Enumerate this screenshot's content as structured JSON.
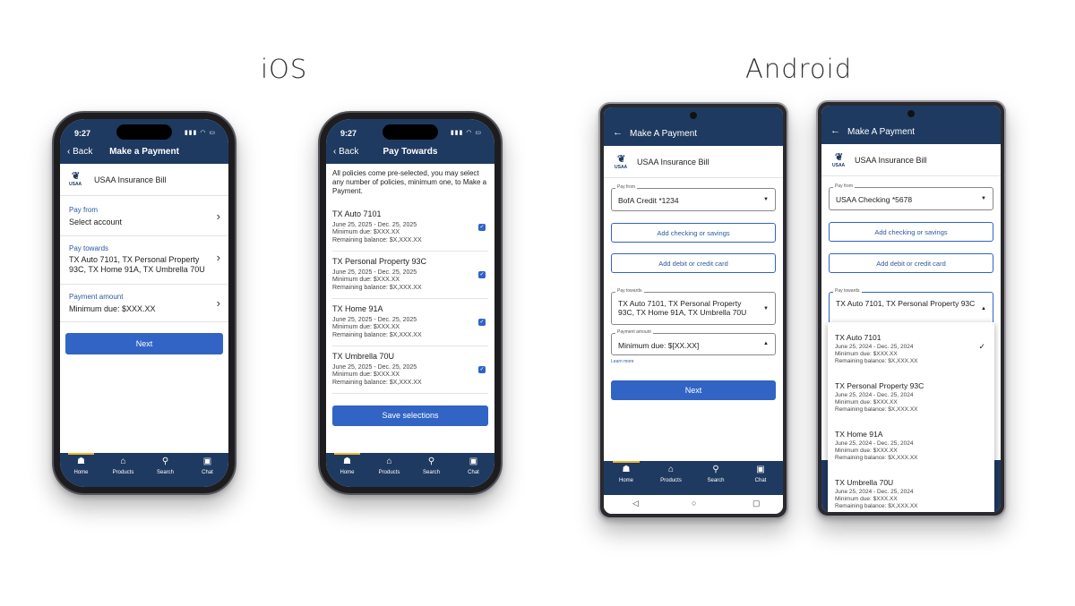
{
  "headings": {
    "ios": "iOS",
    "android": "Android"
  },
  "ios_status": {
    "time": "9:27",
    "icons": "▮▮▮ ◠ ▭"
  },
  "bill_title": "USAA Insurance Bill",
  "usaa_mark": "USAA",
  "tabs": [
    {
      "label": "Home",
      "icon": "home-icon"
    },
    {
      "label": "Products",
      "icon": "products-icon"
    },
    {
      "label": "Search",
      "icon": "search-icon"
    },
    {
      "label": "Chat",
      "icon": "chat-icon"
    }
  ],
  "ios_payment": {
    "back": "‹ Back",
    "title": "Make a Payment",
    "pay_from_label": "Pay from",
    "pay_from_value": "Select account",
    "pay_towards_label": "Pay towards",
    "pay_towards_value": "TX Auto 7101, TX Personal Property 93C, TX Home 91A, TX Umbrella 70U",
    "payment_amount_label": "Payment amount",
    "payment_amount_value": "Minimum due: $XXX.XX",
    "next_button": "Next"
  },
  "ios_towards": {
    "back": "‹ Back",
    "title": "Pay Towards",
    "intro": "All policies come pre-selected, you may select any number of policies, minimum one, to Make a Payment.",
    "policies": [
      {
        "name": "TX Auto 7101",
        "dates": "June 25, 2025 - Dec. 25, 2025",
        "min_due": "Minimum due: $XXX.XX",
        "balance": "Remaining balance: $X,XXX.XX"
      },
      {
        "name": "TX Personal Property 93C",
        "dates": "June 25, 2025 - Dec. 25, 2025",
        "min_due": "Minimum due: $XXX.XX",
        "balance": "Remaining balance: $X,XXX.XX"
      },
      {
        "name": "TX Home 91A",
        "dates": "June 25, 2025 - Dec. 25, 2025",
        "min_due": "Minimum due: $XXX.XX",
        "balance": "Remaining balance: $X,XXX.XX"
      },
      {
        "name": "TX Umbrella 70U",
        "dates": "June 25, 2025 - Dec. 25, 2025",
        "min_due": "Minimum due: $XXX.XX",
        "balance": "Remaining balance: $X,XXX.XX"
      }
    ],
    "save_button": "Save selections"
  },
  "android_payment": {
    "title": "Make A Payment",
    "pay_from_label": "Pay from",
    "pay_from_value": "BofA Credit *1234",
    "add_checking": "Add checking or savings",
    "add_card": "Add debit or credit card",
    "pay_towards_label": "Pay towards",
    "pay_towards_value": "TX Auto 7101, TX Personal Property 93C, TX Home 91A, TX Umbrella 70U",
    "payment_amount_label": "Payment amount",
    "payment_amount_value": "Minimum due: $[XX.XX]",
    "learn_more": "Learn more",
    "next_button": "Next"
  },
  "android_dropdown": {
    "title": "Make A Payment",
    "pay_from_label": "Pay from",
    "pay_from_value": "USAA Checking *5678",
    "add_checking": "Add checking or savings",
    "add_card": "Add debit or credit card",
    "pay_towards_label": "Pay towards",
    "pay_towards_value": "TX Auto 7101, TX Personal Property 93C",
    "policies": [
      {
        "name": "TX Auto 7101",
        "dates": "June 25, 2024 - Dec. 25, 2024",
        "min_due": "Minimum due: $XXX.XX",
        "balance": "Remaining balance: $X,XXX.XX"
      },
      {
        "name": "TX Personal Property 93C",
        "dates": "June 25, 2024 - Dec. 25, 2024",
        "min_due": "Minimum due: $XXX.XX",
        "balance": "Remaining balance: $X,XXX.XX"
      },
      {
        "name": "TX Home 91A",
        "dates": "June 25, 2024 - Dec. 25, 2024",
        "min_due": "Minimum due: $XXX.XX",
        "balance": "Remaining balance: $X,XXX.XX"
      },
      {
        "name": "TX Umbrella 70U",
        "dates": "June 25, 2024 - Dec. 25, 2024",
        "min_due": "Minimum due: $XXX.XX",
        "balance": "Remaining balance: $X,XXX.XX"
      }
    ]
  },
  "colors": {
    "navy": "#1f3a60",
    "primary_button": "#3164c4",
    "link": "#2c5aa0",
    "active_tab": "#f0b42a"
  }
}
